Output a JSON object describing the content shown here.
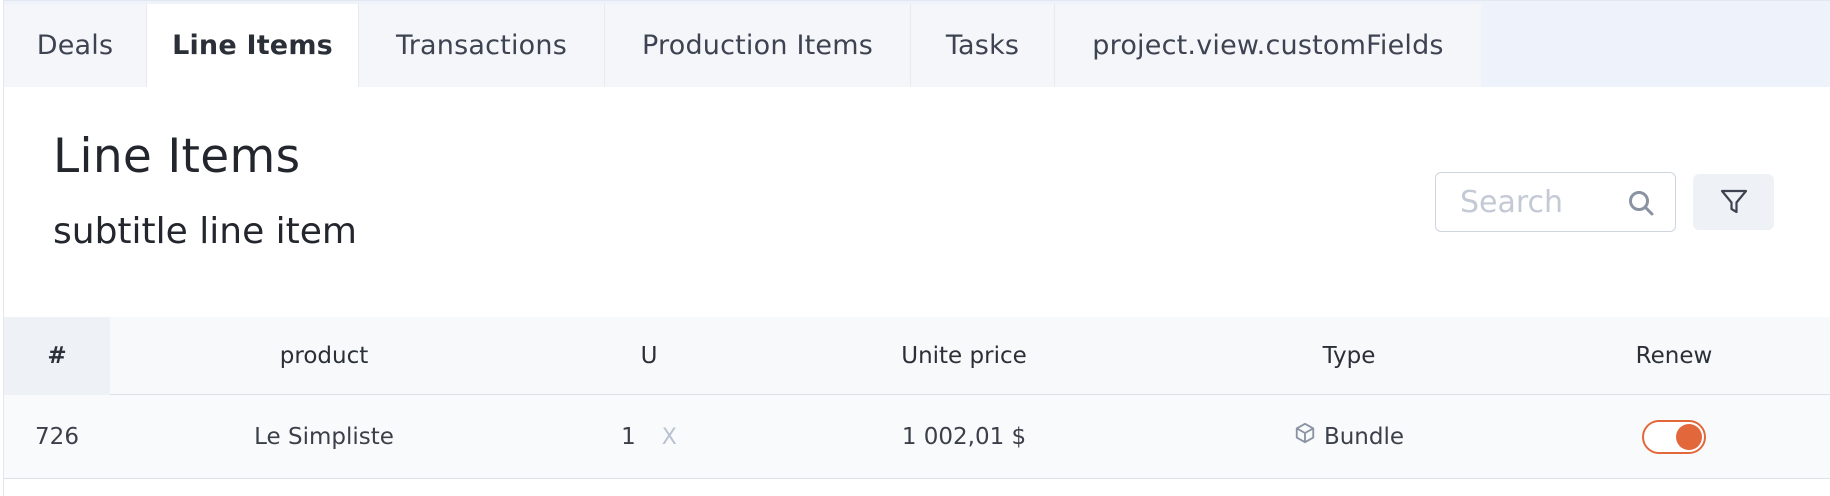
{
  "tabs": [
    {
      "label": "Deals",
      "active": false
    },
    {
      "label": "Line Items",
      "active": true
    },
    {
      "label": "Transactions",
      "active": false
    },
    {
      "label": "Production Items",
      "active": false
    },
    {
      "label": "Tasks",
      "active": false
    },
    {
      "label": "project.view.customFields",
      "active": false
    }
  ],
  "header": {
    "title": "Line Items",
    "subtitle": "subtitle line item"
  },
  "search": {
    "placeholder": "Search",
    "value": ""
  },
  "colors": {
    "accent": "#e2673a",
    "tab_active_bg": "#ffffff",
    "tab_bg": "#f4f6fa"
  },
  "table": {
    "columns": [
      "#",
      "product",
      "U",
      "Unite price",
      "Type",
      "Renew"
    ],
    "rows": [
      {
        "id": "726",
        "product": "Le Simpliste",
        "unit": "1",
        "unit_remove": "X",
        "unit_price": "1 002,01 $",
        "type": "Bundle",
        "type_icon": "cube-icon",
        "renew": true
      }
    ]
  }
}
